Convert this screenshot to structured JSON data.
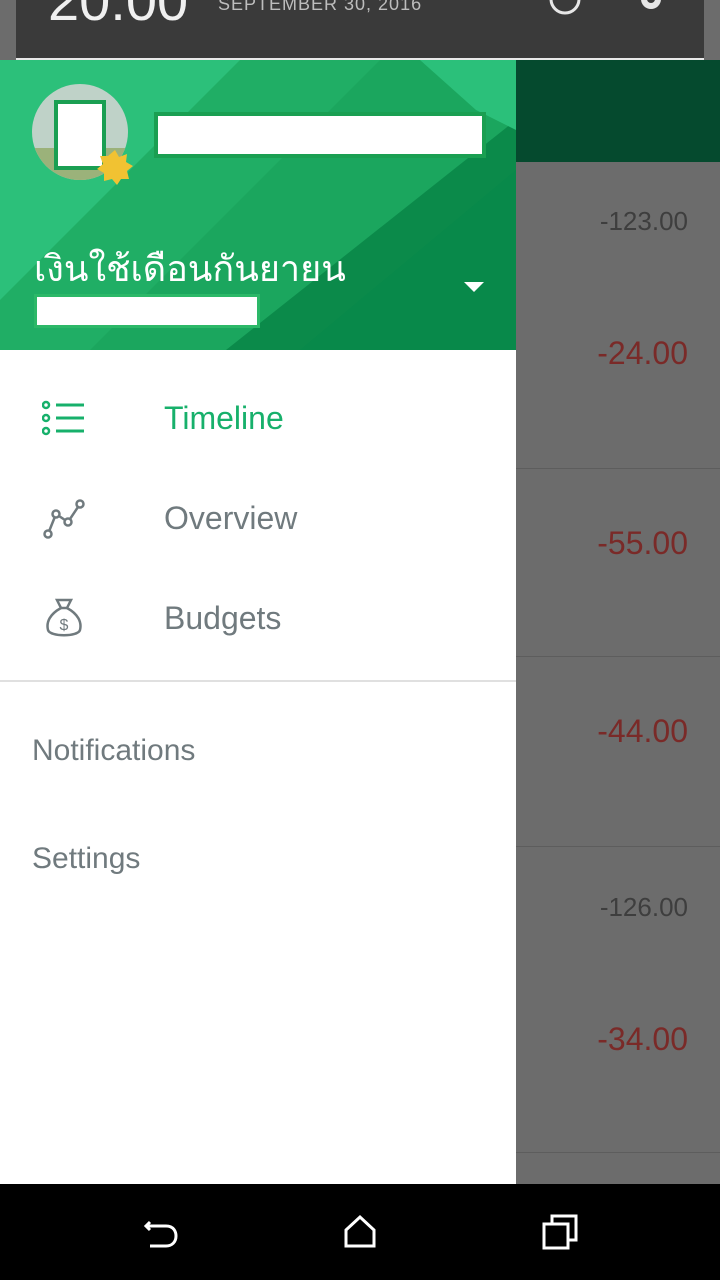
{
  "status_bar": {
    "time": "20:00",
    "date": "SEPTEMBER 30, 2016"
  },
  "drawer": {
    "wallet_name": "เงินใช้เดือนกันยายน",
    "nav_items": [
      {
        "label": "Timeline",
        "icon": "list-icon",
        "active": true
      },
      {
        "label": "Overview",
        "icon": "chart-icon",
        "active": false
      },
      {
        "label": "Budgets",
        "icon": "money-bag-icon",
        "active": false
      }
    ],
    "secondary_items": [
      {
        "label": "Notifications"
      },
      {
        "label": "Settings"
      }
    ]
  },
  "background_list": {
    "amounts": [
      "-123.00",
      "-24.00",
      "-55.00",
      "-44.00",
      "-126.00",
      "-34.00"
    ]
  },
  "colors": {
    "accent": "#17b06b",
    "header_green": "#1e9e5a",
    "dark_green": "#054a2e",
    "negative": "#7a2a28"
  }
}
